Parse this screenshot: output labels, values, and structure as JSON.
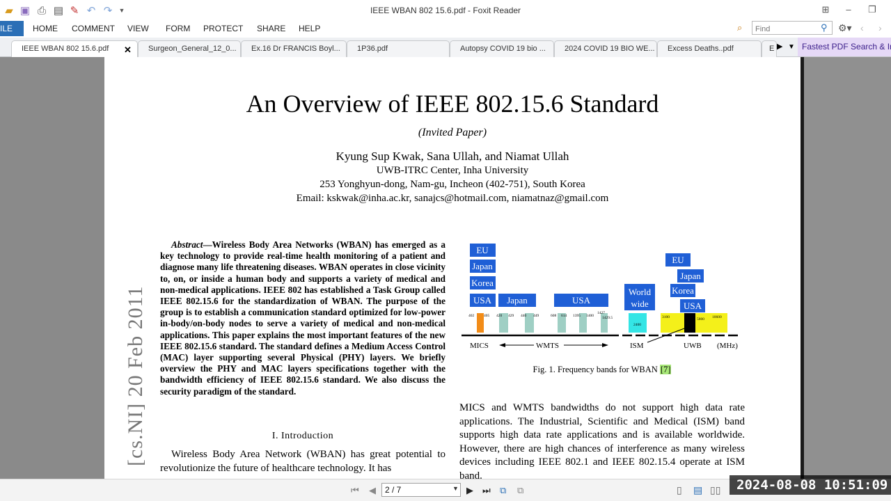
{
  "window": {
    "title": "IEEE WBAN  802 15.6.pdf - Foxit Reader"
  },
  "menu": {
    "file": "ILE",
    "items": [
      "HOME",
      "COMMENT",
      "VIEW",
      "FORM",
      "PROTECT",
      "SHARE",
      "HELP"
    ],
    "find_placeholder": "Find"
  },
  "tabs": [
    {
      "label": "IEEE WBAN  802 15.6.pdf",
      "active": true
    },
    {
      "label": "Surgeon_General_12_0..."
    },
    {
      "label": "Ex.16 Dr FRANCIS Boyl..."
    },
    {
      "label": "1P36.pdf"
    },
    {
      "label": "Autopsy COVID 19 bio ..."
    },
    {
      "label": "2024 COVID 19 BIO WE..."
    },
    {
      "label": "Excess Deaths..pdf"
    },
    {
      "label": "E"
    }
  ],
  "promo": "Fastest PDF Search & In",
  "paper": {
    "title": "An Overview of IEEE 802.15.6 Standard",
    "invited": "(Invited Paper)",
    "authors": "Kyung Sup Kwak, Sana Ullah, and Niamat Ullah",
    "affiliation": "UWB-ITRC Center, Inha University",
    "address": "253 Yonghyun-dong, Nam-gu, Incheon (402-751), South Korea",
    "email": "Email: kskwak@inha.ac.kr, sanajcs@hotmail.com, niamatnaz@gmail.com",
    "arxiv_stamp": "[cs.NI]  20 Feb 2011",
    "abstract_label": "Abstract",
    "abstract_text": "—Wireless Body Area Networks (WBAN) has emerged as a key technology to provide real-time health monitoring of a patient and diagnose many life threatening diseases. WBAN operates in close vicinity to, on, or inside a human body and supports a variety of medical and non-medical applications. IEEE 802 has established a Task Group called IEEE 802.15.6 for the standardization of WBAN. The purpose of the group is to establish a communication standard optimized for low-power in-body/on-body nodes to serve a variety of medical and non-medical applications. This paper explains the most important features of the new IEEE 802.15.6 standard. The standard defines a Medium Access Control (MAC) layer supporting several Physical (PHY) layers. We briefly overview the PHY and MAC layers specifications together with the bandwidth efficiency of IEEE 802.15.6 standard. We also discuss the security paradigm of the standard.",
    "intro_heading": "I. Introduction",
    "intro_text": "Wireless Body Area Network (WBAN) has great potential to revolutionize the future of healthcare technology. It has",
    "right_text": "MICS and WMTS bandwidths do not support high data rate applications. The Industrial, Scientific and Medical (ISM) band supports high data rate applications and is available worldwide. However, there are high chances of interference as many wireless devices including IEEE 802.1 and IEEE 802.15.4 operate at ISM band.",
    "fig_caption": "Fig. 1.   Frequency bands for WBAN ",
    "fig_cite": "[7]"
  },
  "figure": {
    "labels": {
      "eu1": "EU",
      "japan1": "Japan",
      "korea1": "Korea",
      "usa1": "USA",
      "japan2": "Japan",
      "usa2": "USA",
      "world1": "World",
      "world2": "wide",
      "eu2": "EU",
      "japan3": "Japan",
      "korea2": "Korea",
      "usa3": "USA",
      "mics": "MICS",
      "wmts": "WMTS",
      "ism": "ISM",
      "uwb": "UWB",
      "mhz": "(MHz)"
    },
    "freqs": [
      "402",
      "405",
      "420",
      "429",
      "440",
      "449",
      "608",
      "614",
      "1395",
      "1400",
      "1427",
      "1429.5",
      "2400",
      "3100",
      "5800",
      "10600"
    ]
  },
  "status": {
    "page": "2 / 7",
    "timestamp": "2024-08-08  10:51:09"
  }
}
